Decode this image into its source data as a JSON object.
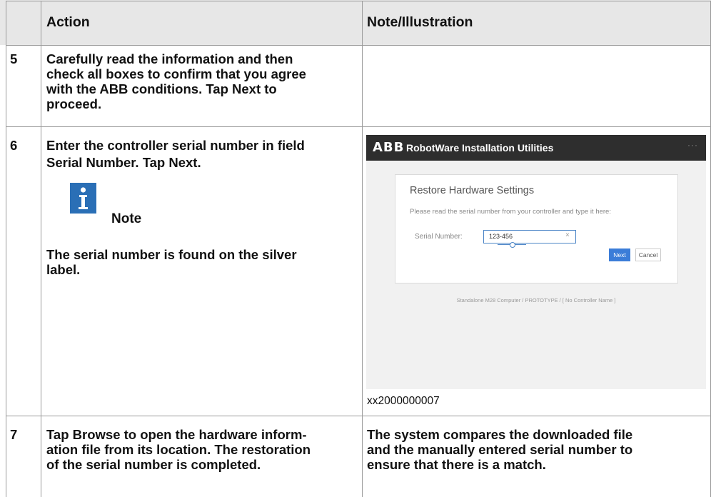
{
  "header": {
    "col_action": "Action",
    "col_note": "Note/Illustration"
  },
  "rows": [
    {
      "num": "5",
      "action_lines": [
        "Carefully read the information and then",
        "check all boxes to confirm that you agree",
        "with the ABB conditions. Tap ",
        "Next",
        " to",
        "proceed."
      ]
    },
    {
      "num": "6",
      "action_line1_pre": "Enter the controller serial number in field",
      "action_line2_bold": "Serial Number",
      "action_line2_mid": ". Tap ",
      "action_line2_bold2": "Next",
      "action_line2_post": ".",
      "note_label": "Note",
      "note_text_line1": "The serial number is found on the silver",
      "note_text_line2": "label.",
      "figure_caption": "xx2000000007"
    },
    {
      "num": "7",
      "action_line1_pre": "Tap ",
      "action_line1_bold": "Browse",
      "action_line1_post": " to open the hardware inform-",
      "action_line2": "ation file from its location. The restoration",
      "action_line3": "of the serial number is completed.",
      "note_line1": "The system compares the downloaded file",
      "note_line2": "and the manually entered serial number to",
      "note_line3": "ensure that there is a match."
    }
  ],
  "screenshot": {
    "logo": "ABB",
    "app_title": "RobotWare Installation Utilities",
    "menu_dots": "···",
    "dialog_title": "Restore Hardware Settings",
    "dialog_subtitle": "Please read the serial number from your controller and type it here:",
    "field_label": "Serial Number:",
    "field_value": "123-456",
    "clear_symbol": "×",
    "next_button": "Next",
    "cancel_button": "Cancel",
    "footer": "Standalone M28 Computer / PROTOTYPE / [ No Controller Name ]",
    "colors": {
      "bar": "#2e2e2e",
      "accent": "#3b7dd8"
    }
  },
  "icons": {
    "note": "info-note-icon"
  }
}
